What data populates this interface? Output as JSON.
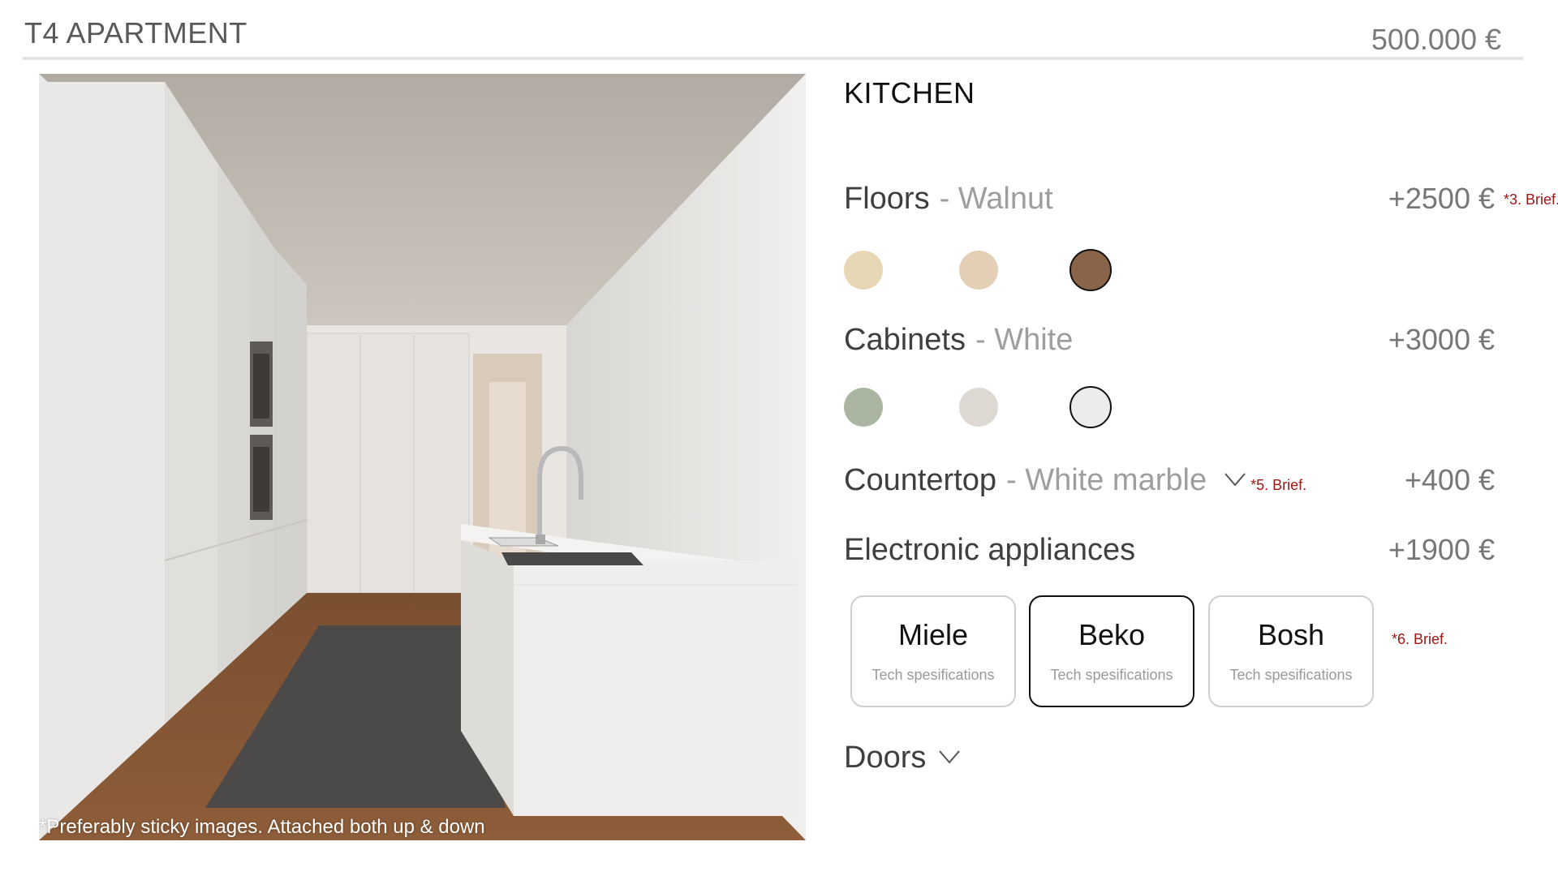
{
  "header": {
    "title": "T4 APARTMENT",
    "total_price": "500.000 €"
  },
  "render": {
    "caption": "*Preferably sticky images. Attached both up & down"
  },
  "kitchen": {
    "section_title": "KITCHEN",
    "floors": {
      "label": "Floors",
      "value": "- Walnut",
      "price": "+2500 €",
      "brief": "*3. Brief.",
      "swatches": [
        {
          "name": "light-burl",
          "color": "#e8d7b4",
          "selected": false
        },
        {
          "name": "birch",
          "color": "#e3cfb6",
          "selected": false
        },
        {
          "name": "walnut",
          "color": "#8a6448",
          "selected": true
        }
      ]
    },
    "cabinets": {
      "label": "Cabinets",
      "value": "- White",
      "price": "+3000 €",
      "swatches": [
        {
          "name": "sage",
          "color": "#aab5a2",
          "selected": false
        },
        {
          "name": "greige",
          "color": "#ded8d2",
          "selected": false
        },
        {
          "name": "white",
          "color": "#ebebea",
          "selected": true
        }
      ]
    },
    "countertop": {
      "label": "Countertop",
      "value": "- White marble",
      "price": "+400 €",
      "brief": "*5. Brief."
    },
    "appliances": {
      "label": "Electronic appliances",
      "price": "+1900 €",
      "brief": "*6. Brief.",
      "brands": [
        {
          "name": "Miele",
          "sub": "Tech spesifications",
          "selected": false
        },
        {
          "name": "Beko",
          "sub": "Tech spesifications",
          "selected": true
        },
        {
          "name": "Bosh",
          "sub": "Tech spesifications",
          "selected": false
        }
      ]
    },
    "doors": {
      "label": "Doors"
    }
  },
  "colors": {
    "brief_red": "#a01818",
    "accent_dark": "#111111"
  }
}
